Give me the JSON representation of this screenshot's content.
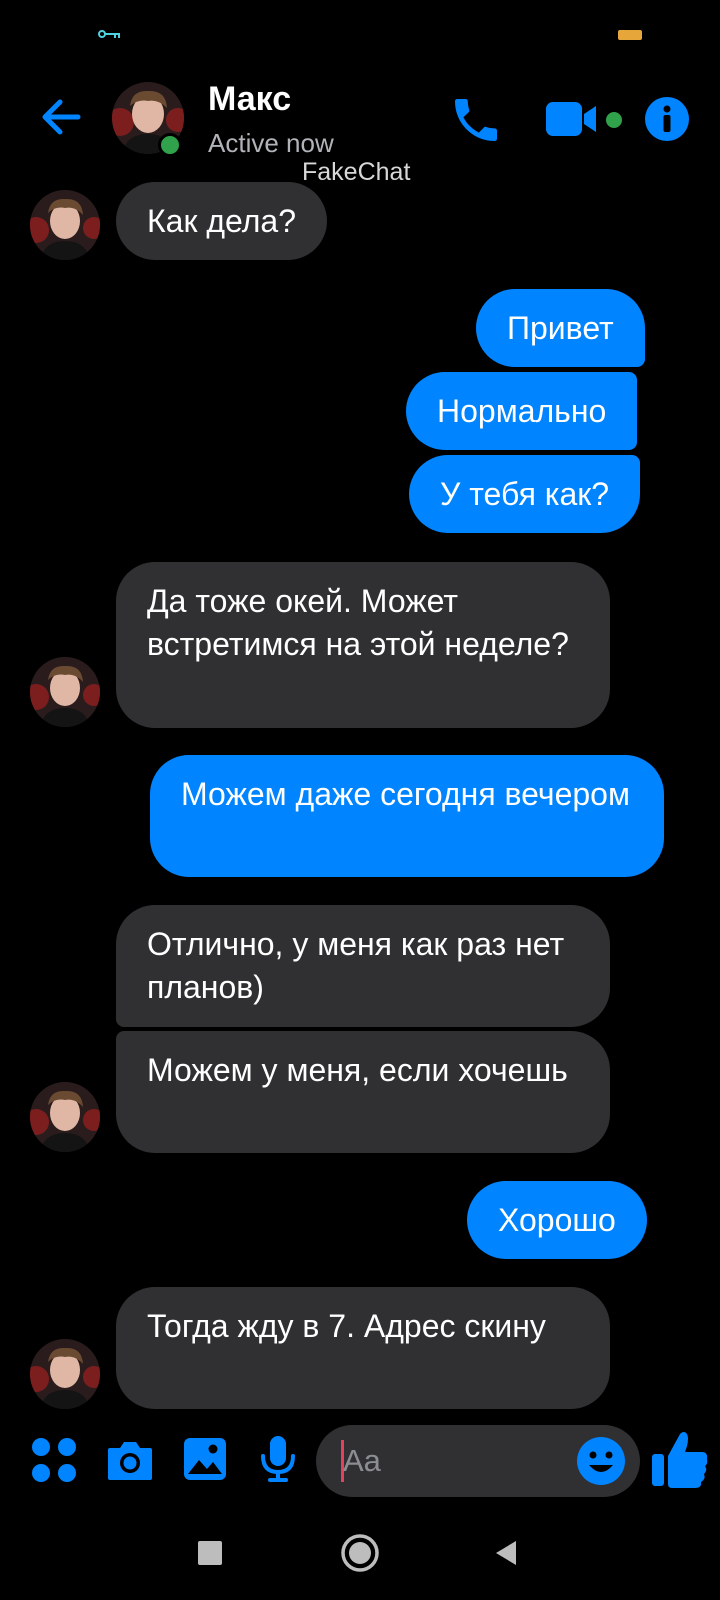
{
  "theme": {
    "accent": "#0084ff",
    "incoming_bubble": "#303033",
    "presence": "#31a24c",
    "background": "#000000"
  },
  "header": {
    "name": "Макс",
    "status": "Active now",
    "watermark": "FakeChat",
    "icons": [
      "back-arrow-icon",
      "phone-icon",
      "video-camera-icon",
      "info-icon"
    ]
  },
  "messages": [
    {
      "dir": "in",
      "text": "Как дела?"
    },
    {
      "dir": "out",
      "text": "Привет"
    },
    {
      "dir": "out",
      "text": "Нормально"
    },
    {
      "dir": "out",
      "text": "У тебя как?"
    },
    {
      "dir": "in",
      "text": "Да тоже окей. Может встретимся на этой неделе?"
    },
    {
      "dir": "out",
      "text": "Можем даже сегодня вечером"
    },
    {
      "dir": "in",
      "text": "Отлично, у меня как раз нет планов)"
    },
    {
      "dir": "in",
      "text": "Можем у меня, если хочешь"
    },
    {
      "dir": "out",
      "text": "Хорошо"
    },
    {
      "dir": "in",
      "text": "Тогда жду в 7. Адрес скину"
    }
  ],
  "composer": {
    "placeholder": "Aa",
    "icons": [
      "apps-grid-icon",
      "camera-icon",
      "gallery-icon",
      "microphone-icon",
      "emoji-icon",
      "thumbs-up-icon"
    ]
  },
  "nav": {
    "icons": [
      "recent-apps-icon",
      "home-icon",
      "back-triangle-icon"
    ]
  }
}
